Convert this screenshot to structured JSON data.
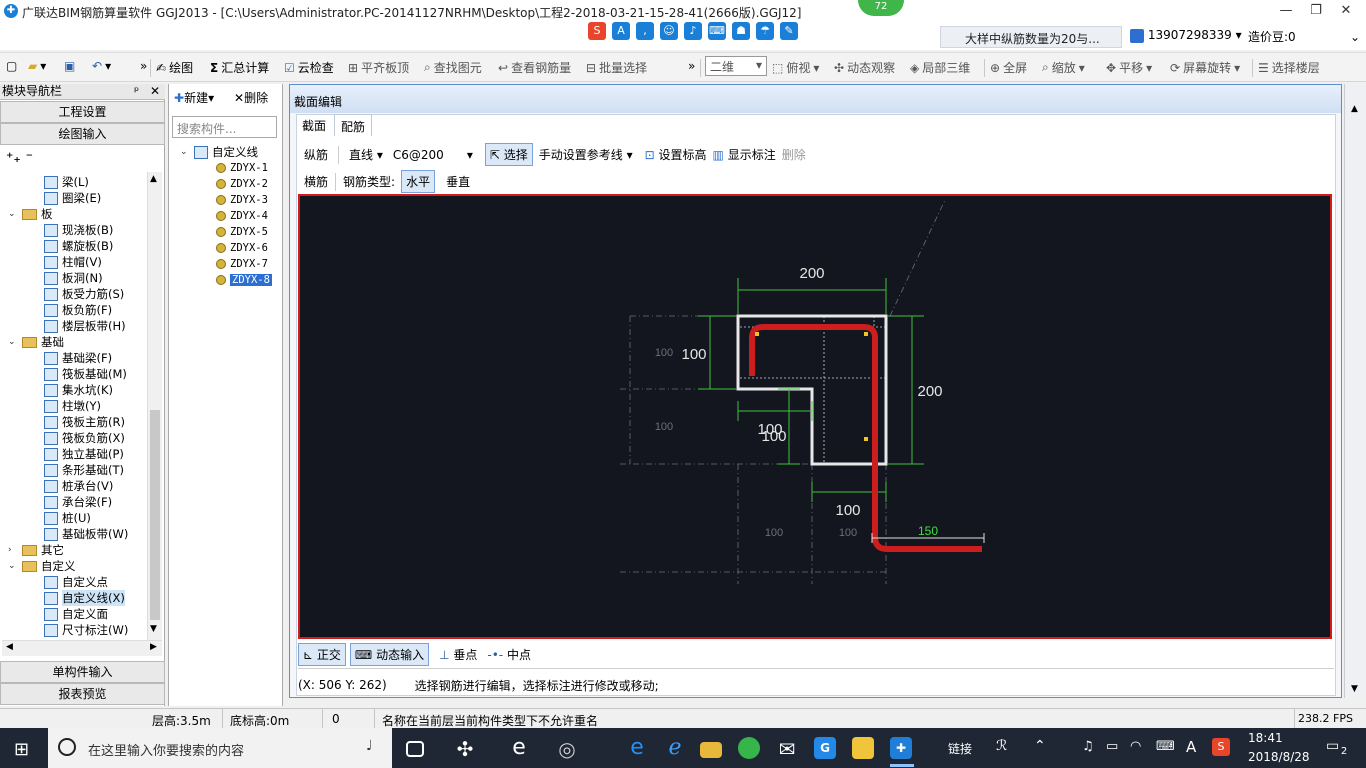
{
  "window": {
    "title": "广联达BIM钢筋算量软件 GGJ2013 - [C:\\Users\\Administrator.PC-20141127NRHM\\Desktop\\工程2-2018-03-21-15-28-41(2666版).GGJ12]",
    "badge": "72",
    "controls": [
      "—",
      "❐",
      "✕"
    ]
  },
  "topbar": {
    "notice": "大样中纵筋数量为20与...",
    "user": "13907298339",
    "price": "造价豆:0"
  },
  "toolbar": {
    "items": [
      "绘图",
      "汇总计算",
      "云检查",
      "平齐板顶",
      "查找图元",
      "查看钢筋量",
      "批量选择"
    ],
    "view_mode": "二维",
    "right_items": [
      "俯视",
      "动态观察",
      "局部三维",
      "全屏",
      "缩放",
      "平移",
      "屏幕旋转",
      "选择楼层"
    ]
  },
  "nav": {
    "header": "模块导航栏",
    "buttons": [
      "工程设置",
      "绘图输入"
    ],
    "bottom_buttons": [
      "单构件输入",
      "报表预览"
    ],
    "tree": [
      {
        "label": "梁(L)",
        "type": "leaf"
      },
      {
        "label": "圈梁(E)",
        "type": "leaf"
      },
      {
        "label": "板",
        "type": "folder"
      },
      {
        "label": "现浇板(B)",
        "type": "leaf"
      },
      {
        "label": "螺旋板(B)",
        "type": "leaf"
      },
      {
        "label": "柱帽(V)",
        "type": "leaf"
      },
      {
        "label": "板洞(N)",
        "type": "leaf"
      },
      {
        "label": "板受力筋(S)",
        "type": "leaf"
      },
      {
        "label": "板负筋(F)",
        "type": "leaf"
      },
      {
        "label": "楼层板带(H)",
        "type": "leaf"
      },
      {
        "label": "基础",
        "type": "folder"
      },
      {
        "label": "基础梁(F)",
        "type": "leaf"
      },
      {
        "label": "筏板基础(M)",
        "type": "leaf"
      },
      {
        "label": "集水坑(K)",
        "type": "leaf"
      },
      {
        "label": "柱墩(Y)",
        "type": "leaf"
      },
      {
        "label": "筏板主筋(R)",
        "type": "leaf"
      },
      {
        "label": "筏板负筋(X)",
        "type": "leaf"
      },
      {
        "label": "独立基础(P)",
        "type": "leaf"
      },
      {
        "label": "条形基础(T)",
        "type": "leaf"
      },
      {
        "label": "桩承台(V)",
        "type": "leaf"
      },
      {
        "label": "承台梁(F)",
        "type": "leaf"
      },
      {
        "label": "桩(U)",
        "type": "leaf"
      },
      {
        "label": "基础板带(W)",
        "type": "leaf"
      },
      {
        "label": "其它",
        "type": "folder-closed"
      },
      {
        "label": "自定义",
        "type": "folder"
      },
      {
        "label": "自定义点",
        "type": "leaf"
      },
      {
        "label": "自定义线(X)",
        "type": "leaf-selected"
      },
      {
        "label": "自定义面",
        "type": "leaf"
      },
      {
        "label": "尺寸标注(W)",
        "type": "leaf"
      }
    ]
  },
  "components": {
    "new_label": "新建",
    "delete_label": "删除",
    "search_placeholder": "搜索构件...",
    "root": "自定义线",
    "items": [
      "ZDYX-1",
      "ZDYX-2",
      "ZDYX-3",
      "ZDYX-4",
      "ZDYX-5",
      "ZDYX-6",
      "ZDYX-7",
      "ZDYX-8"
    ],
    "selected": "ZDYX-8"
  },
  "editor": {
    "title": "截面编辑",
    "tabs": [
      "截面",
      "配筋"
    ],
    "active_tab": "配筋",
    "row1": {
      "label": "纵筋",
      "line_type": "直线",
      "spec": "C6@200",
      "select": "选择",
      "manual_ref": "手动设置参考线",
      "set_elev": "设置标高",
      "show_dims": "显示标注",
      "delete": "删除"
    },
    "row2": {
      "label": "横筋",
      "type_label": "钢筋类型:",
      "horizontal": "水平",
      "vertical": "垂直"
    },
    "canvas": {
      "dims": [
        "200",
        "100",
        "200",
        "100",
        "100",
        "100",
        "150"
      ],
      "faint_dims": [
        "100",
        "100",
        "100",
        "100"
      ]
    },
    "bottom_tools": [
      "正交",
      "动态输入",
      "垂点",
      "中点"
    ],
    "coords": "(X: 506 Y: 262)",
    "hint": "选择钢筋进行编辑，选择标注进行修改或移动;"
  },
  "statusbar": {
    "floor_height": "层高:3.5m",
    "base_height": "底标高:0m",
    "value": "0",
    "message": "名称在当前层当前构件类型下不允许重名",
    "fps": "238.2 FPS"
  },
  "taskbar": {
    "search_placeholder": "在这里输入你要搜索的内容",
    "link": "链接",
    "ime": "A",
    "time": "18:41",
    "date": "2018/8/28",
    "notifications": "2"
  },
  "colors": {
    "canvas_bg": "#14161f",
    "rebar": "#cc1e1e",
    "dim_green": "#3ec43e",
    "frame_red": "#d21b1b",
    "accent_blue": "#2d6fd1"
  }
}
